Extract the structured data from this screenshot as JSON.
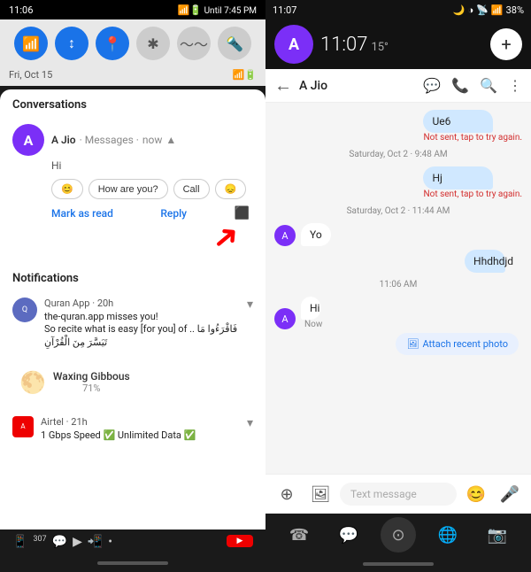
{
  "left": {
    "statusBar": {
      "time": "11:06",
      "signal": "📶",
      "battery": "🔋",
      "until": "Until 7:45 PM"
    },
    "quickSettings": {
      "icons": [
        "wifi",
        "data",
        "location",
        "bluetooth",
        "sync",
        "flashlight"
      ]
    },
    "dateRow": {
      "date": "Fri, Oct 15",
      "signal": "📶"
    },
    "conversations": {
      "sectionTitle": "Conversations",
      "item": {
        "initial": "A",
        "name": "A Jio",
        "source": "Messages",
        "time": "now",
        "message": "Hi",
        "quickReplies": [
          "😊",
          "How are you?",
          "Call",
          "😞"
        ],
        "markRead": "Mark as read",
        "reply": "Reply"
      }
    },
    "notifications": {
      "sectionTitle": "Notifications",
      "items": [
        {
          "icon": "Q",
          "name": "Quran App",
          "time": "20h",
          "body": "the-quran.app misses you!\nSo recite what is easy [for you] of .. فَاقْرَءُوا مَا تَيَسَّرَ مِنَ الْقُرْآنِ"
        }
      ]
    },
    "moonWidget": {
      "icon": "🌕",
      "title": "Waxing Gibbous",
      "percent": "71%"
    },
    "airtelNotif": {
      "name": "Airtel",
      "time": "21h",
      "body": "1 Gbps Speed ✅ Unlimited Data ✅"
    },
    "bottomIcons": [
      "📱",
      "307",
      "💬",
      "▶",
      "📲",
      "•"
    ]
  },
  "right": {
    "statusBar": {
      "time": "11:07",
      "icons": [
        "🌙",
        "◑",
        "📡",
        "📶"
      ],
      "battery": "38%"
    },
    "floatingHeader": {
      "initial": "A",
      "time": "11:07",
      "temp": "15°",
      "addBtn": "+"
    },
    "chatHeader": {
      "contactName": "A Jio",
      "icons": [
        "💬",
        "📞",
        "🔍",
        "⋮"
      ]
    },
    "messages": [
      {
        "type": "sent",
        "text": "Ue6",
        "error": "Not sent, tap to try again."
      },
      {
        "type": "divider",
        "text": "Saturday, Oct 2 · 9:48 AM"
      },
      {
        "type": "sent",
        "text": "Hj",
        "error": "Not sent, tap to try again."
      },
      {
        "type": "divider",
        "text": "Saturday, Oct 2 · 11:44 AM"
      },
      {
        "type": "received",
        "initial": "A",
        "text": "Yo"
      },
      {
        "type": "sent",
        "text": "Hhdhdjd"
      },
      {
        "type": "divider",
        "text": "11:06 AM"
      },
      {
        "type": "received",
        "initial": "A",
        "text": "Hi",
        "subtext": "Now"
      },
      {
        "type": "attach",
        "text": "Attach recent photo"
      }
    ],
    "inputArea": {
      "addIcon": "+",
      "galleryIcon": "🖼",
      "placeholder": "Text message",
      "emojiIcon": "😊",
      "micIcon": "🎤"
    },
    "bottomNav": {
      "items": [
        "☎",
        "💬",
        "⊙",
        "🌐",
        "📷"
      ]
    }
  }
}
